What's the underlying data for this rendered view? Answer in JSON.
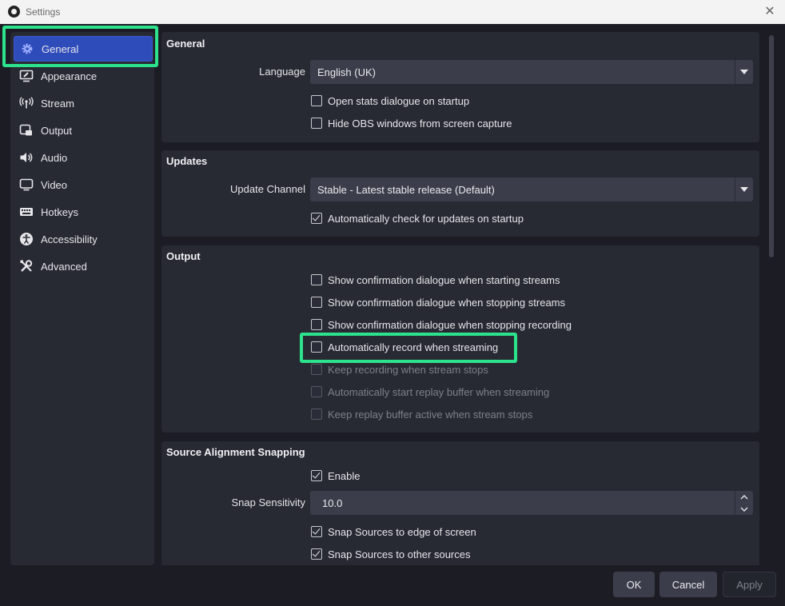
{
  "window": {
    "title": "Settings",
    "close_glyph": "✕"
  },
  "sidebar": {
    "items": [
      {
        "label": "General",
        "icon": "gear-icon",
        "active": true
      },
      {
        "label": "Appearance",
        "icon": "appearance-icon"
      },
      {
        "label": "Stream",
        "icon": "antenna-icon"
      },
      {
        "label": "Output",
        "icon": "output-icon"
      },
      {
        "label": "Audio",
        "icon": "speaker-icon"
      },
      {
        "label": "Video",
        "icon": "monitor-icon"
      },
      {
        "label": "Hotkeys",
        "icon": "keyboard-icon"
      },
      {
        "label": "Accessibility",
        "icon": "accessibility-icon"
      },
      {
        "label": "Advanced",
        "icon": "wrench-icon"
      }
    ]
  },
  "general": {
    "title": "General",
    "language_label": "Language",
    "language_value": "English (UK)",
    "checks": [
      {
        "label": "Open stats dialogue on startup",
        "checked": false
      },
      {
        "label": "Hide OBS windows from screen capture",
        "checked": false
      }
    ]
  },
  "updates": {
    "title": "Updates",
    "channel_label": "Update Channel",
    "channel_value": "Stable - Latest stable release (Default)",
    "checks": [
      {
        "label": "Automatically check for updates on startup",
        "checked": true
      }
    ]
  },
  "output": {
    "title": "Output",
    "checks": [
      {
        "label": "Show confirmation dialogue when starting streams",
        "checked": false
      },
      {
        "label": "Show confirmation dialogue when stopping streams",
        "checked": false
      },
      {
        "label": "Show confirmation dialogue when stopping recording",
        "checked": false
      },
      {
        "label": "Automatically record when streaming",
        "checked": false
      },
      {
        "label": "Keep recording when stream stops",
        "checked": false,
        "disabled": true
      },
      {
        "label": "Automatically start replay buffer when streaming",
        "checked": false,
        "disabled": true
      },
      {
        "label": "Keep replay buffer active when stream stops",
        "checked": false,
        "disabled": true
      }
    ]
  },
  "snapping": {
    "title": "Source Alignment Snapping",
    "enable_label": "Enable",
    "enable_checked": true,
    "sensitivity_label": "Snap Sensitivity",
    "sensitivity_value": "10.0",
    "checks": [
      {
        "label": "Snap Sources to edge of screen",
        "checked": true
      },
      {
        "label": "Snap Sources to other sources",
        "checked": true
      }
    ]
  },
  "buttons": {
    "ok": "OK",
    "cancel": "Cancel",
    "apply": "Apply"
  },
  "colors": {
    "highlight": "#2de28c",
    "accent": "#2f4cbb",
    "panel": "#272a33",
    "background": "#1b1c24"
  }
}
